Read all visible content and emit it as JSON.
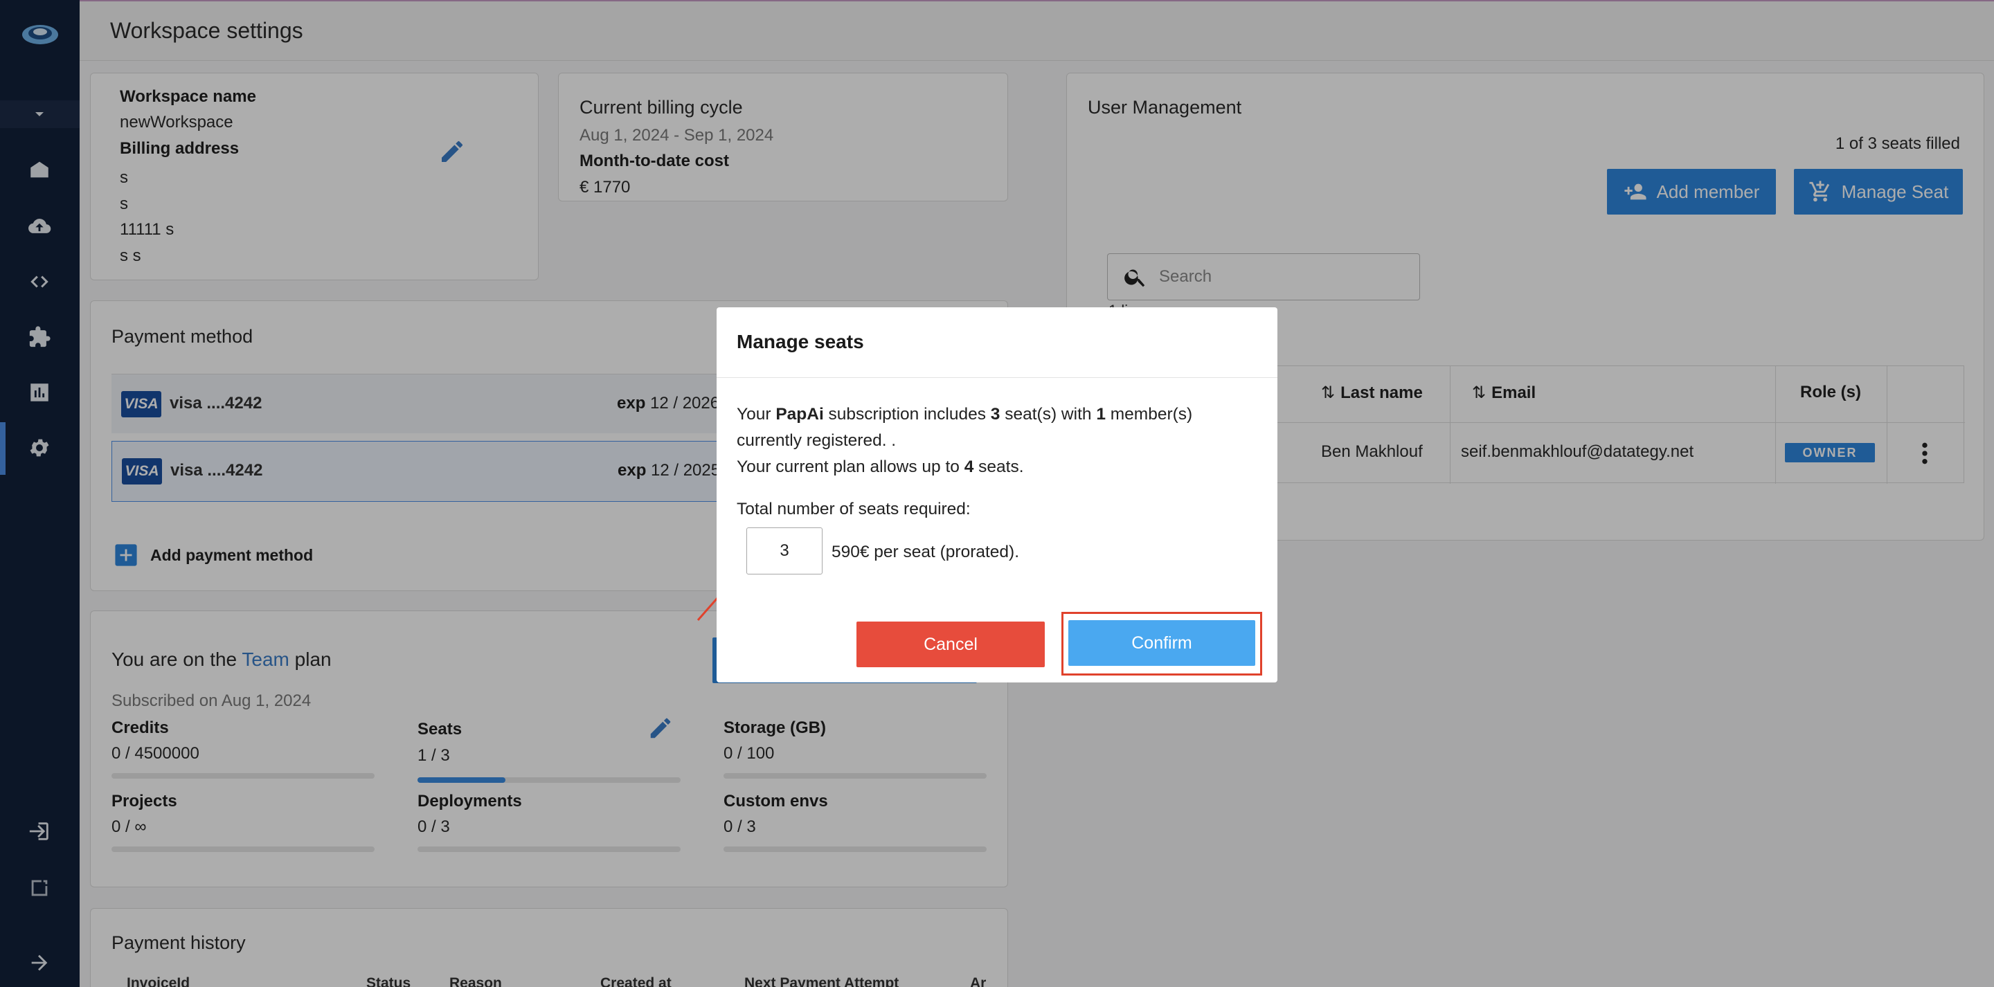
{
  "header": {
    "title": "Workspace settings"
  },
  "sidebar": {
    "items": [
      {
        "name": "logo",
        "icon": "logo-icon"
      },
      {
        "name": "dropdown",
        "icon": "caret-down-icon"
      },
      {
        "name": "inbox",
        "icon": "inbox-icon"
      },
      {
        "name": "upload",
        "icon": "cloud-upload-icon"
      },
      {
        "name": "code",
        "icon": "code-icon"
      },
      {
        "name": "extensions",
        "icon": "puzzle-icon"
      },
      {
        "name": "analytics",
        "icon": "chart-icon"
      },
      {
        "name": "settings",
        "icon": "gear-icon"
      },
      {
        "name": "logout",
        "icon": "logout-icon"
      },
      {
        "name": "avatar",
        "icon": "broken-image-icon"
      },
      {
        "name": "expand",
        "icon": "arrow-right-icon"
      }
    ]
  },
  "workspace": {
    "name_label": "Workspace name",
    "name_value": "newWorkspace",
    "billing_label": "Billing address",
    "address": [
      "s",
      "s",
      "11111 s",
      "s s"
    ]
  },
  "billing": {
    "title": "Current billing cycle",
    "dates": "Aug 1, 2024 - Sep 1, 2024",
    "cost_label": "Month-to-date cost",
    "cost_value": "€ 1770"
  },
  "payment": {
    "title": "Payment method",
    "cards": [
      {
        "brand": "VISA",
        "number": "visa ....4242",
        "exp_label": "exp",
        "exp_value": "12 / 2026"
      },
      {
        "brand": "VISA",
        "number": "visa ....4242",
        "exp_label": "exp",
        "exp_value": "12 / 2025"
      }
    ],
    "add_label": "Add payment method"
  },
  "plan": {
    "title_prefix": "You are on the ",
    "plan_name": "Team",
    "title_suffix": " plan",
    "subscribed": "Subscribed on Aug 1, 2024",
    "metrics": [
      {
        "label": "Credits",
        "value": "0 / 4500000",
        "fraction": 0
      },
      {
        "label": "Seats",
        "value": "1 / 3",
        "fraction": 0.333
      },
      {
        "label": "Storage (GB)",
        "value": "0 / 100",
        "fraction": 0
      },
      {
        "label": "Projects",
        "value": "0 / ∞",
        "fraction": 0
      },
      {
        "label": "Deployments",
        "value": "0 / 3",
        "fraction": 0
      },
      {
        "label": "Custom envs",
        "value": "0 / 3",
        "fraction": 0
      }
    ]
  },
  "history": {
    "title": "Payment history",
    "columns": [
      "InvoiceId",
      "Status",
      "Reason",
      "Created at",
      "Next Payment Attempt",
      "Ar"
    ]
  },
  "users": {
    "title": "User Management",
    "seats_filled": "1 of 3 seats filled",
    "add_member_label": "Add member",
    "manage_seat_label": "Manage Seat",
    "search_placeholder": "Search",
    "columns": [
      "Last name",
      "Email",
      "Role (s)"
    ],
    "rows": [
      {
        "last_name": "Ben Makhlouf",
        "email": "seif.benmakhlouf@datategy.net",
        "role": "OWNER"
      }
    ],
    "hidden_text": "1 li"
  },
  "dialog": {
    "title": "Manage seats",
    "line1_a": "Your ",
    "line1_b": "PapAi",
    "line1_c": " subscription includes ",
    "line1_d": "3",
    "line1_e": " seat(s) with ",
    "line1_f": "1",
    "line1_g": " member(s)",
    "line2": "currently registered. .",
    "line3_a": "Your current plan allows up to ",
    "line3_b": "4",
    "line3_c": " seats.",
    "seats_label": "Total number of seats required:",
    "seats_value": "3",
    "price_text": "590€ per seat (prorated).",
    "cancel_label": "Cancel",
    "confirm_label": "Confirm"
  },
  "colors": {
    "accent": "#2e86de",
    "cancel": "#e74c3c",
    "confirm": "#4aa8f0",
    "highlight": "#e0422c",
    "sidebar": "#13213a"
  }
}
